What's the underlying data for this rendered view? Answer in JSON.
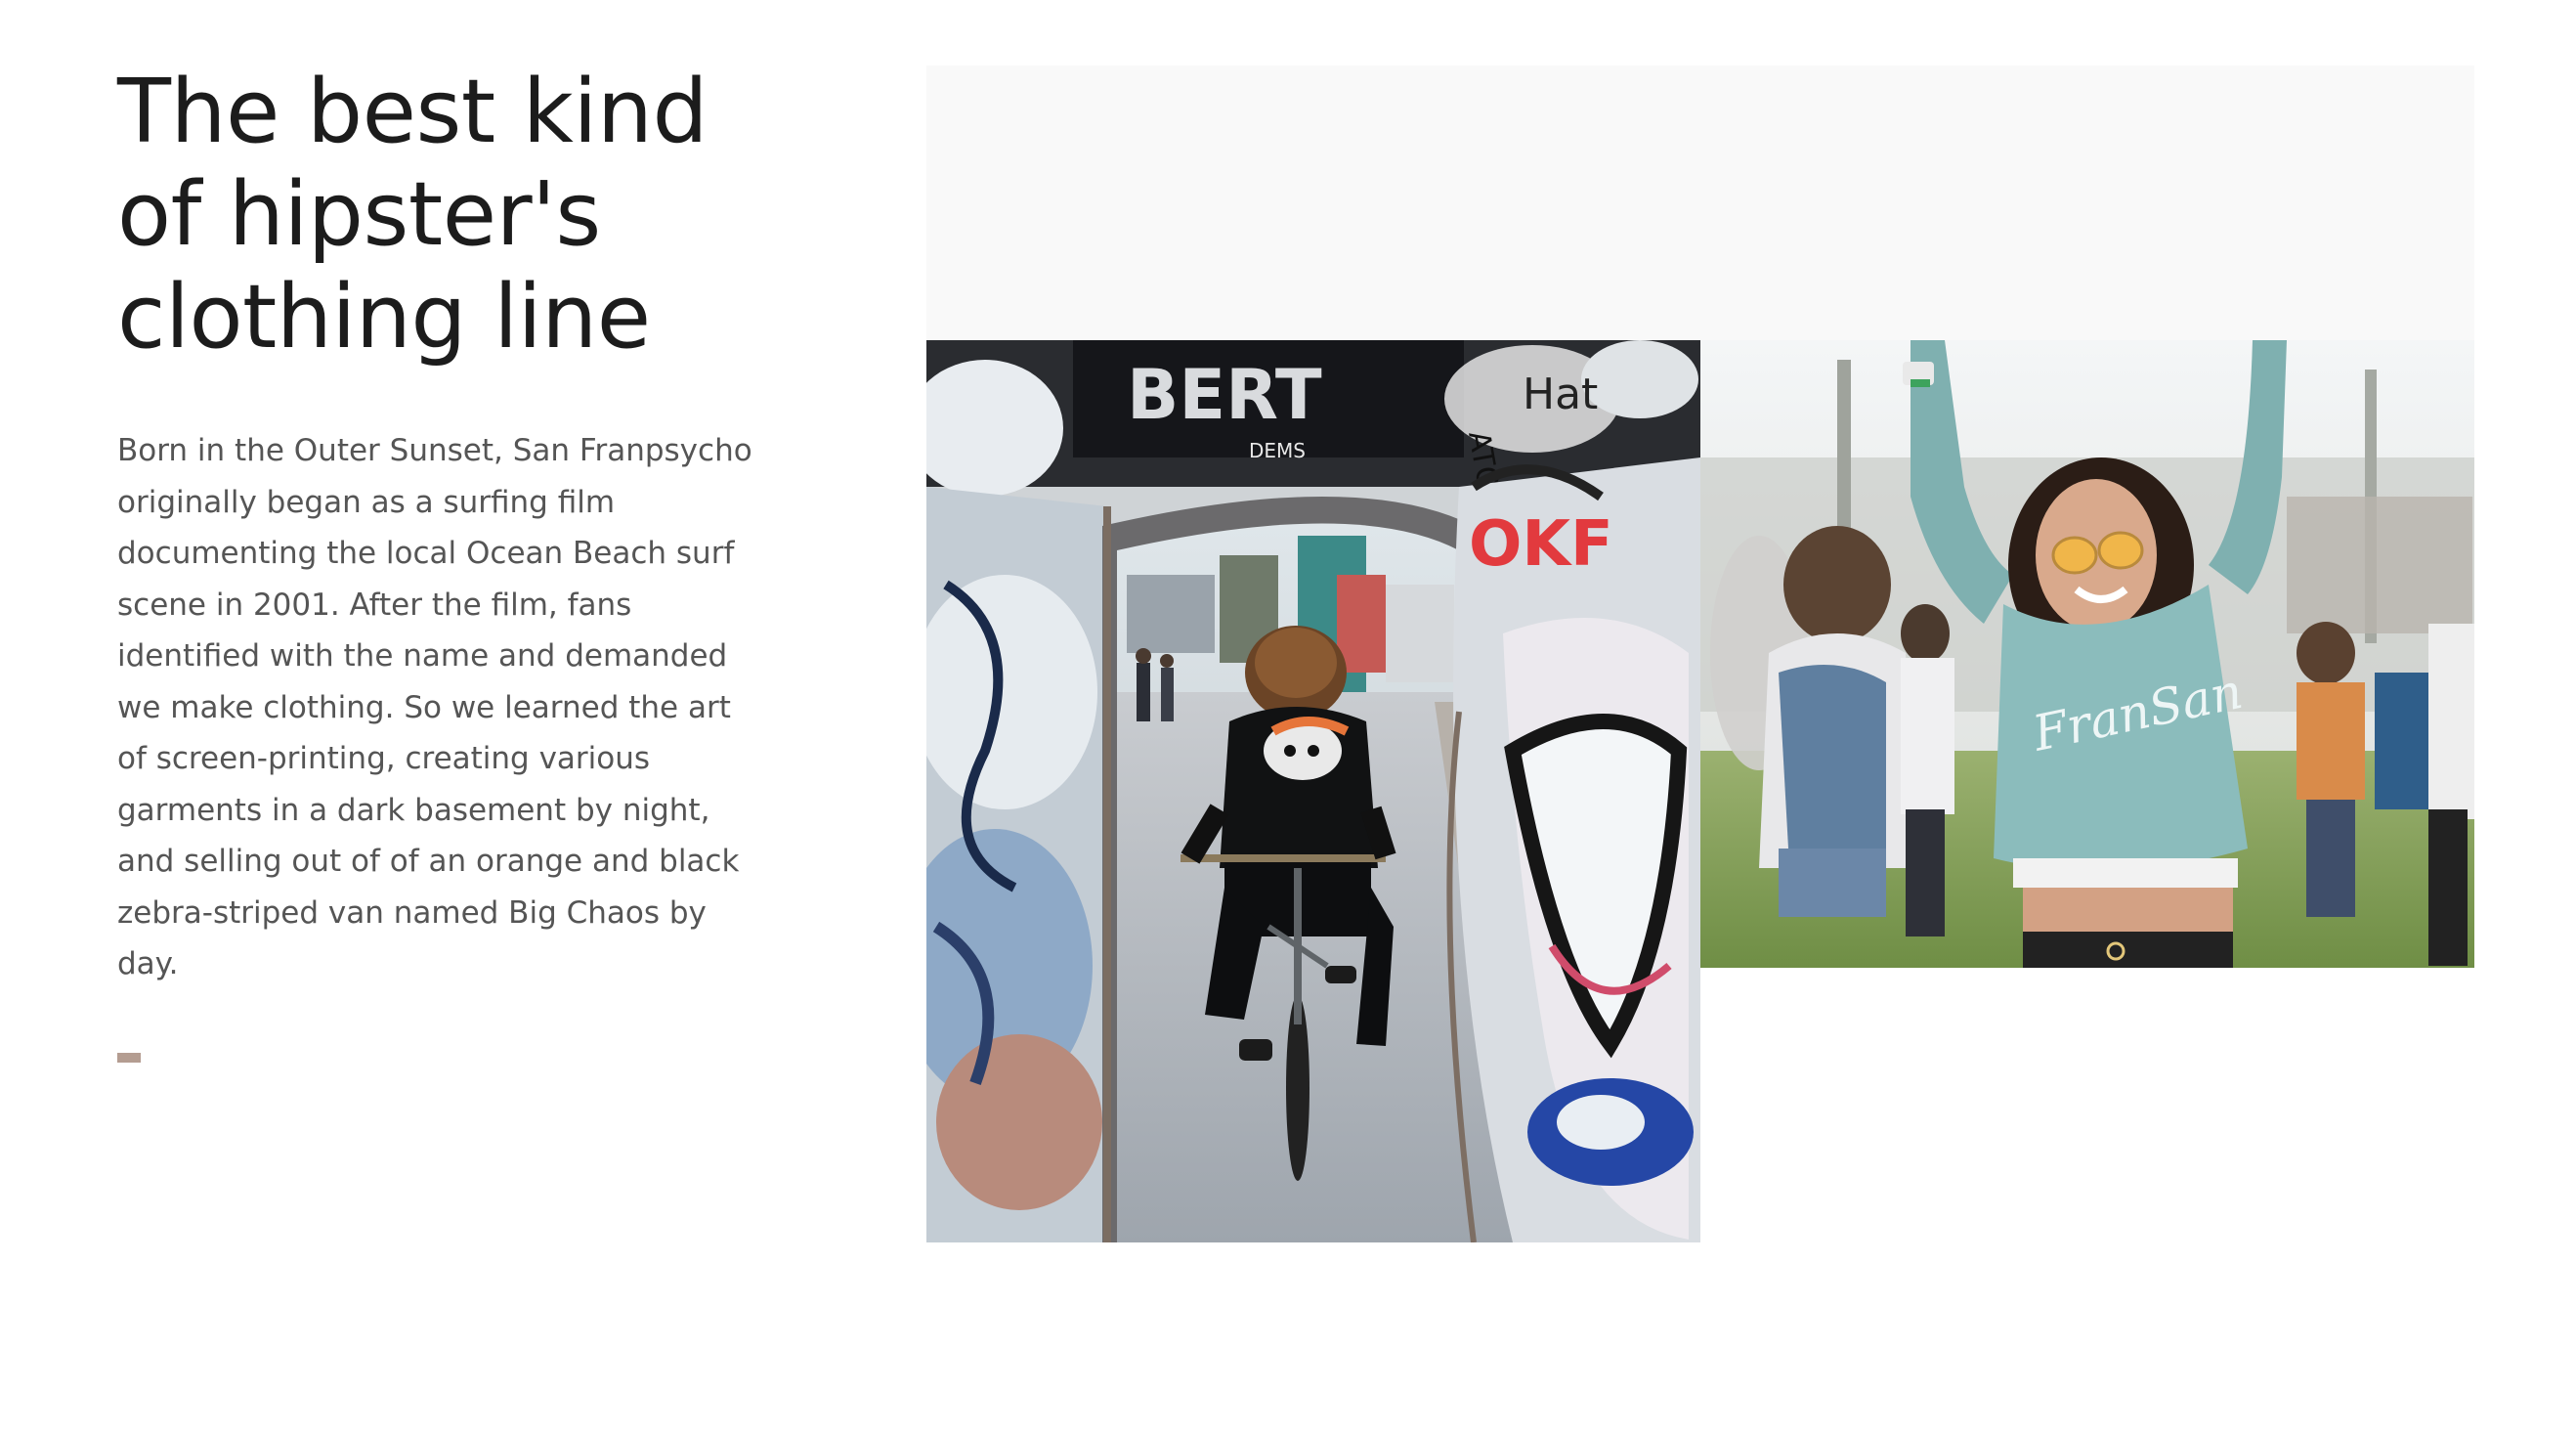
{
  "section": {
    "headline": "The best kind\nof hipster's\nclothing line",
    "body": "Born in the Outer Sunset, San Franpsycho\noriginally began as a surfing film\ndocumenting the local Ocean Beach surf\nscene in 2001. After the film, fans\nidentified with the name and demanded\nwe make clothing. So we learned the art\nof screen-printing, creating various\ngarments in a dark basement by night,\nand selling out of of an orange and black\nzebra-striped van named Big Chaos by\nday."
  },
  "gallery": {
    "photos": [
      {
        "name": "skatepark-cyclist-photo"
      },
      {
        "name": "festival-woman-photo"
      }
    ],
    "graffiti_tags": [
      "OKF",
      "DEMS",
      "ATOR",
      "Hat"
    ],
    "sweatshirt_text": "FranSan"
  },
  "colors": {
    "heading": "#1c1c1c",
    "body": "#555555",
    "accent": "#b49d91",
    "gallery_background": "#f9f9f9"
  }
}
